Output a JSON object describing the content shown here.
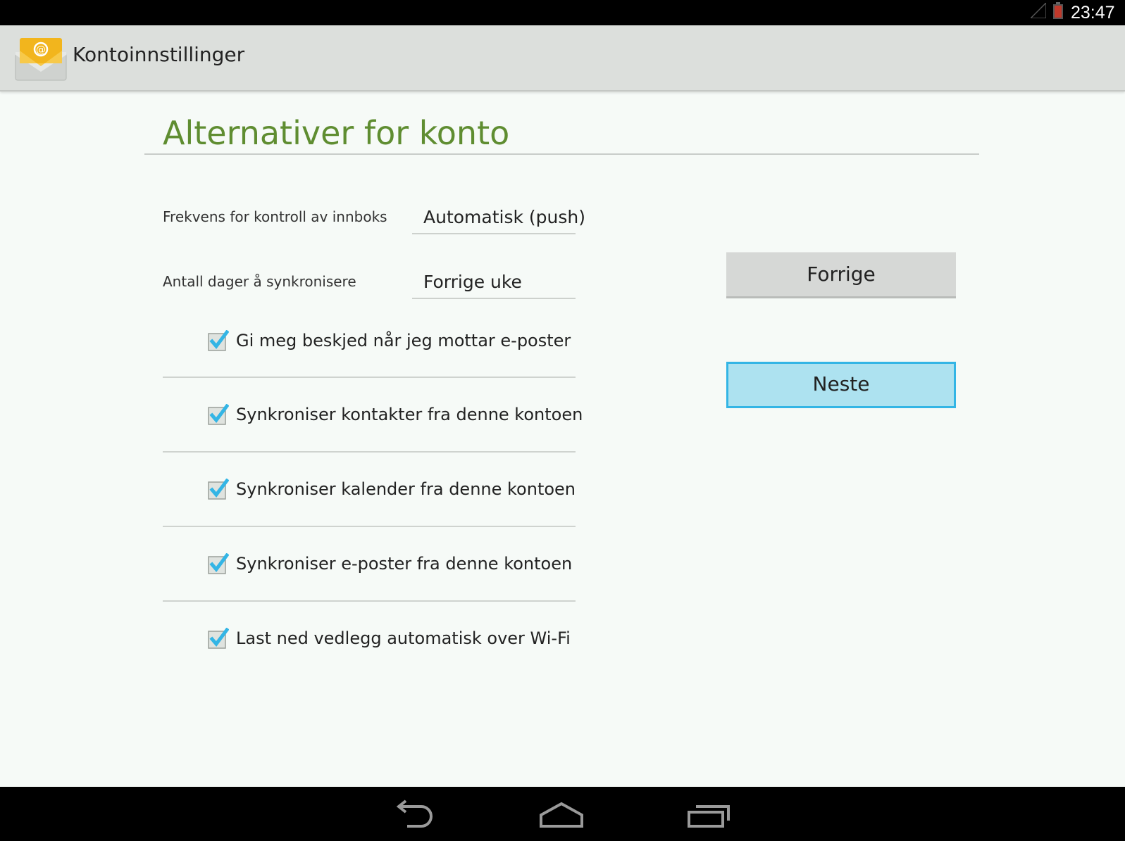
{
  "status_bar": {
    "time": "23:47",
    "icons": [
      "signal-icon",
      "battery-icon"
    ]
  },
  "action_bar": {
    "app_icon": "email-icon",
    "title": "Kontoinnstillinger"
  },
  "page": {
    "heading": "Alternativer for konto"
  },
  "settings": {
    "frequency": {
      "label": "Frekvens for kontroll av innboks",
      "value": "Automatisk (push)"
    },
    "sync_days": {
      "label": "Antall dager å synkronisere",
      "value": "Forrige uke"
    }
  },
  "checkboxes": [
    {
      "label": "Gi meg beskjed når jeg mottar e-poster",
      "checked": true
    },
    {
      "label": "Synkroniser kontakter fra denne kontoen",
      "checked": true
    },
    {
      "label": "Synkroniser kalender fra denne kontoen",
      "checked": true
    },
    {
      "label": "Synkroniser e-poster fra denne kontoen",
      "checked": true
    },
    {
      "label": "Last ned vedlegg automatisk over Wi-Fi",
      "checked": true
    }
  ],
  "buttons": {
    "previous": "Forrige",
    "next": "Neste"
  },
  "nav_bar": {
    "icons": [
      "back-icon",
      "home-icon",
      "recent-apps-icon"
    ]
  },
  "colors": {
    "heading": "#5f8d31",
    "accent": "#33b5e5",
    "next_button_fill": "#ade2f0"
  }
}
